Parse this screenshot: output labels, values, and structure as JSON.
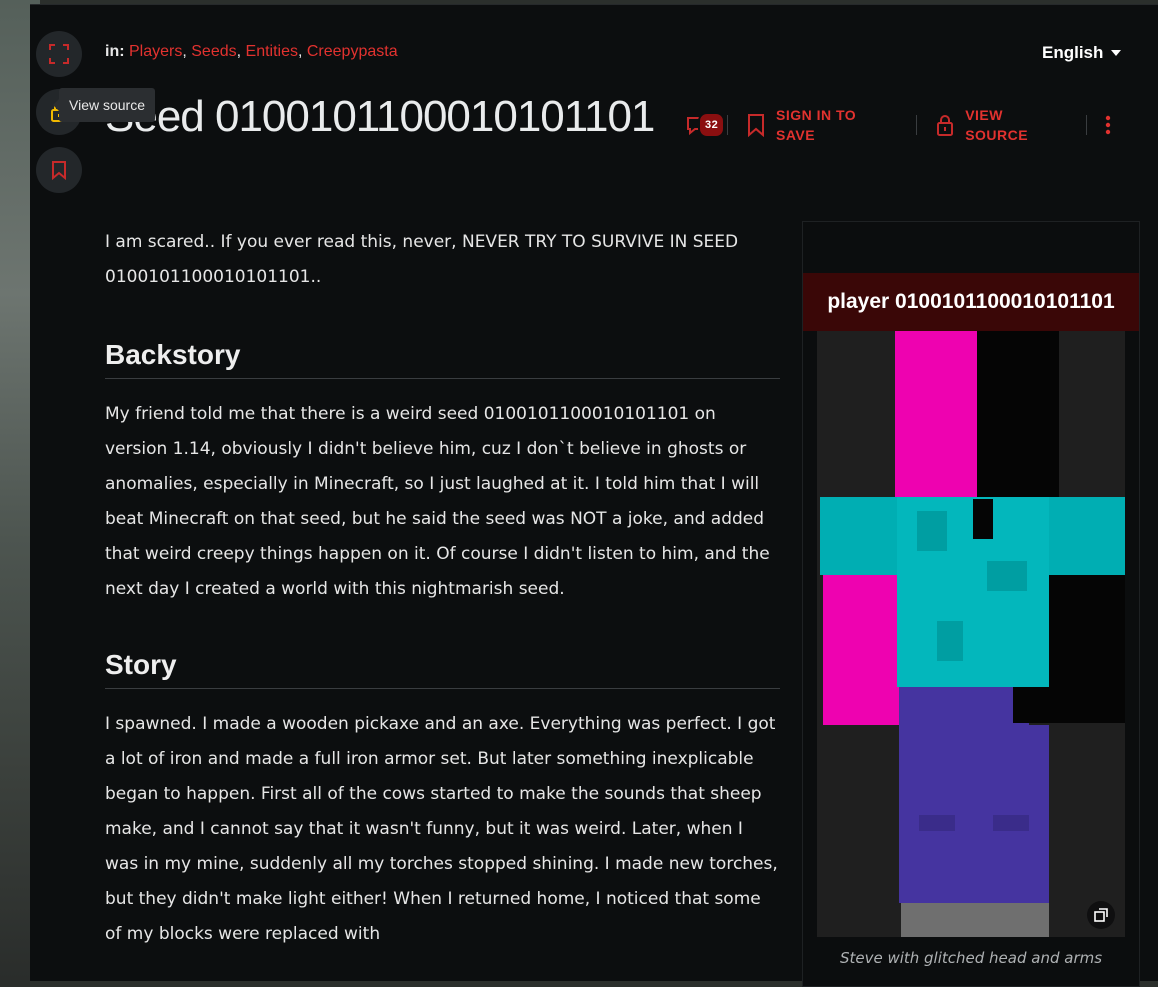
{
  "categories": {
    "prefix": "in:",
    "items": [
      "Players",
      "Seeds",
      "Entities",
      "Creepypasta"
    ]
  },
  "language": "English",
  "tooltip": "View source",
  "title": "Seed 0100101100010101101",
  "actions": {
    "comments_count": "32",
    "sign_in_line1": "SIGN IN TO",
    "sign_in_line2": "SAVE",
    "view_source_line1": "VIEW",
    "view_source_line2": "SOURCE"
  },
  "article": {
    "intro": "I am scared.. If you ever read this, never, NEVER TRY TO SURVIVE IN SEED 0100101100010101101..",
    "backstory_heading": "Backstory",
    "backstory": "My friend told me that there is a weird seed 0100101100010101101 on version 1.14, obviously I didn't believe him, cuz I don`t believe in ghosts or anomalies, especially in Minecraft, so I just laughed at it. I told him that I will beat Minecraft on that seed, but he said the seed was NOT a joke, and added that weird creepy things happen on it. Of course I didn't listen to him, and the next day I created a world with this nightmarish seed.",
    "story_heading": "Story",
    "story": "I spawned. I made a wooden pickaxe and an axe. Everything was perfect. I got a lot of iron and made a full iron armor set. But later something inexplicable began to happen. First all of the cows started to make the sounds that sheep make, and I cannot say that it wasn't funny, but it was weird. Later, when I was in my mine, suddenly all my torches stopped shining. I made new torches, but they didn't make light either! When I returned home, I noticed that some of my blocks were replaced with"
  },
  "infobox": {
    "title": "player 0100101100010101101",
    "caption": "Steve with glitched head and arms"
  },
  "colors": {
    "accent": "#e2322f",
    "magenta": "#ee02b0",
    "cyan": "#00b3b8",
    "purple": "#4534a0",
    "infobox_header": "#3a0707"
  }
}
